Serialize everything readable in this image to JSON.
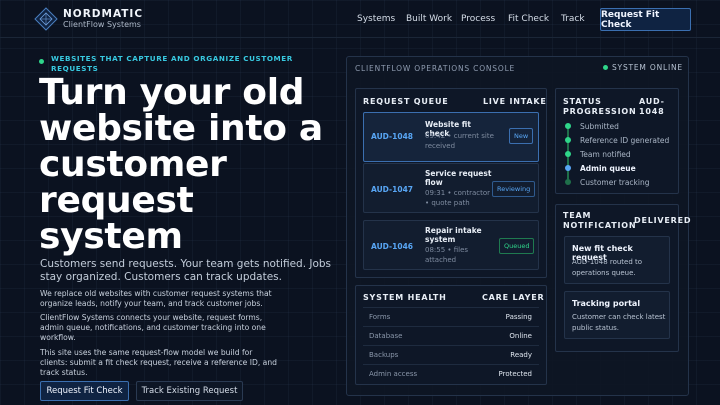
{
  "nav": {
    "brand_name": "NORDMATIC",
    "brand_sub": "ClientFlow Systems",
    "links": [
      "Systems",
      "Built Work",
      "Process",
      "Fit Check",
      "Track"
    ],
    "cta": "Request Fit Check",
    "logo_icon": "diamond-grid-icon"
  },
  "hero": {
    "eyebrow": "WEBSITES THAT CAPTURE AND ORGANIZE CUSTOMER REQUESTS",
    "title": "Turn your old website into a customer request system",
    "subtitle": "Customers send requests. Your team gets notified. Jobs stay organized. Customers can track updates.",
    "paragraphs": [
      "We replace old websites with customer request systems that organize leads, notify your team, and track customer jobs.",
      "ClientFlow Systems connects your website, request forms, admin queue, notifications, and customer tracking into one workflow.",
      "This site uses the same request-flow model we build for clients: submit a fit check request, receive a reference ID, and track status."
    ],
    "primary_button": "Request Fit Check",
    "secondary_button": "Track Existing Request"
  },
  "console": {
    "title": "CLIENTFLOW OPERATIONS CONSOLE",
    "status": "SYSTEM ONLINE",
    "queue": {
      "heading": "REQUEST QUEUE",
      "label": "LIVE INTAKE",
      "items": [
        {
          "id": "AUD-1048",
          "title": "Website fit check",
          "meta": "09:42 • current site received",
          "badge": "New"
        },
        {
          "id": "AUD-1047",
          "title": "Service request flow",
          "meta": "09:31 • contractor • quote path",
          "badge": "Reviewing"
        },
        {
          "id": "AUD-1046",
          "title": "Repair intake system",
          "meta": "08:55 • files attached",
          "badge": "Queued"
        }
      ]
    },
    "progression": {
      "heading": "STATUS PROGRESSION",
      "ref": "AUD-1048",
      "steps": [
        "Submitted",
        "Reference ID generated",
        "Team notified",
        "Admin queue",
        "Customer tracking"
      ]
    },
    "notification": {
      "heading": "TEAM NOTIFICATION",
      "label": "DELIVERED",
      "cards": [
        {
          "title": "New fit check request",
          "body": "AUD-1048 routed to operations queue."
        },
        {
          "title": "Tracking portal",
          "body": "Customer can check latest public status."
        }
      ]
    },
    "health": {
      "heading": "SYSTEM HEALTH",
      "label": "CARE LAYER",
      "rows": [
        {
          "key": "Forms",
          "value": "Passing"
        },
        {
          "key": "Database",
          "value": "Online"
        },
        {
          "key": "Backups",
          "value": "Ready"
        },
        {
          "key": "Admin access",
          "value": "Protected"
        }
      ]
    }
  },
  "colors": {
    "accent_green": "#2fd58a",
    "accent_cyan": "#38c9e0",
    "accent_blue": "#58a6f5",
    "background": "#0b1220"
  }
}
